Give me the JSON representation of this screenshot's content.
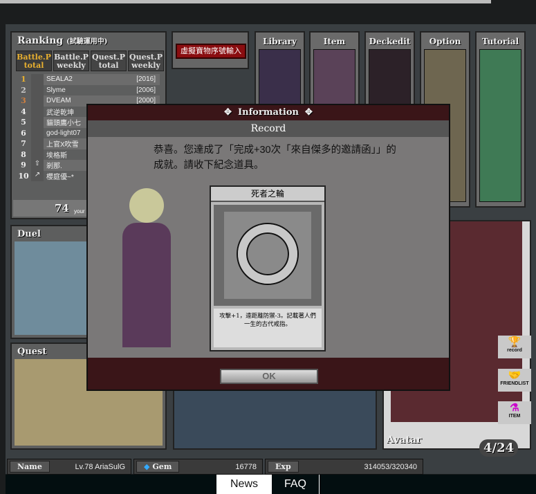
{
  "ranking": {
    "title": "Ranking",
    "subtitle": "(試驗運用中)",
    "tabs": [
      {
        "label": "Battle.P total"
      },
      {
        "label": "Battle.P weekly"
      },
      {
        "label": "Quest.P total"
      },
      {
        "label": "Quest.P weekly"
      }
    ],
    "rows": [
      {
        "rank": "1",
        "trend": "",
        "name": "SEALA2",
        "score": "[2016]"
      },
      {
        "rank": "2",
        "trend": "",
        "name": "Slyme",
        "score": "[2006]"
      },
      {
        "rank": "3",
        "trend": "",
        "name": "DVEAM",
        "score": "[2000]"
      },
      {
        "rank": "4",
        "trend": "",
        "name": "武逆乾坤",
        "score": ""
      },
      {
        "rank": "5",
        "trend": "",
        "name": "貓頭鷹小七",
        "score": ""
      },
      {
        "rank": "6",
        "trend": "",
        "name": "god-light07",
        "score": ""
      },
      {
        "rank": "7",
        "trend": "",
        "name": "上官X吹雪",
        "score": ""
      },
      {
        "rank": "8",
        "trend": "",
        "name": "埃格斯",
        "score": ""
      },
      {
        "rank": "9",
        "trend": "⇧",
        "name": "剎那.",
        "score": ""
      },
      {
        "rank": "10",
        "trend": "↗",
        "name": "櫻庭優~*",
        "score": ""
      }
    ],
    "your_rank": "74",
    "your_label": "your"
  },
  "menu": {
    "serial_button": "虛擬寶物序號輸入",
    "cards": [
      "Library",
      "Item",
      "Deckedit",
      "Option",
      "Tutorial"
    ]
  },
  "sections": {
    "duel": "Duel",
    "quest": "Quest",
    "avatar": "Avatar"
  },
  "side_buttons": [
    {
      "label": "record",
      "icon": "trophy-icon"
    },
    {
      "label": "FRIENDLIST",
      "icon": "handshake-icon"
    },
    {
      "label": "ITEM",
      "icon": "potion-icon"
    }
  ],
  "avatar_count": "4/24",
  "modal": {
    "header": "Information",
    "subtitle": "Record",
    "message": "恭喜。您達成了「完成+30次「來自傑多的邀請函」」的成就。請收下紀念道具。",
    "item_name": "死者之輪",
    "item_desc": "攻擊+1，遠距離防禦-3。記載著人們一生的古代戒指。",
    "ok": "OK"
  },
  "status": {
    "name_label": "Name",
    "name": "Lv.78 AriaSulG",
    "gem_label": "Gem",
    "gem": "16778",
    "exp_label": "Exp",
    "exp": "314053/320340"
  },
  "nav": {
    "news": "News",
    "faq": "FAQ"
  }
}
